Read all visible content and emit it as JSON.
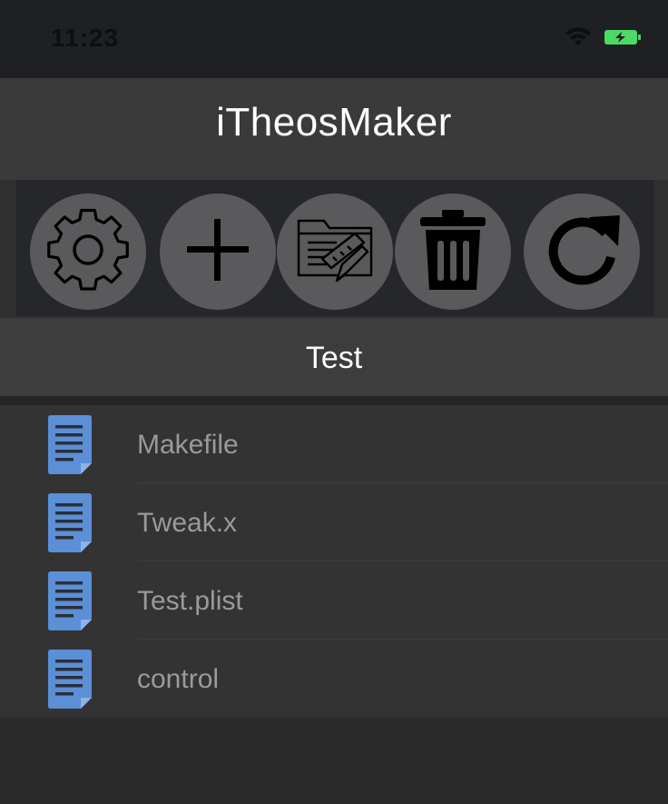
{
  "status_bar": {
    "time": "11:23",
    "icons": [
      "wifi-icon",
      "battery-charging-icon"
    ],
    "battery_color": "#4cd964"
  },
  "app": {
    "title": "iTheosMaker"
  },
  "toolbar": {
    "buttons": [
      {
        "name": "settings",
        "icon": "gear-icon"
      },
      {
        "name": "add",
        "icon": "plus-icon"
      },
      {
        "name": "edit-project",
        "icon": "folder-edit-icon"
      },
      {
        "name": "delete",
        "icon": "trash-icon"
      },
      {
        "name": "refresh",
        "icon": "refresh-icon"
      }
    ]
  },
  "project": {
    "title": "Test"
  },
  "files": [
    {
      "name": "Makefile",
      "icon": "document-icon"
    },
    {
      "name": "Tweak.x",
      "icon": "document-icon"
    },
    {
      "name": "Test.plist",
      "icon": "document-icon"
    },
    {
      "name": "control",
      "icon": "document-icon"
    }
  ],
  "colors": {
    "file_icon": "#5b8fd6",
    "accent_text": "#ffffff",
    "file_text": "#9a9a9c"
  }
}
